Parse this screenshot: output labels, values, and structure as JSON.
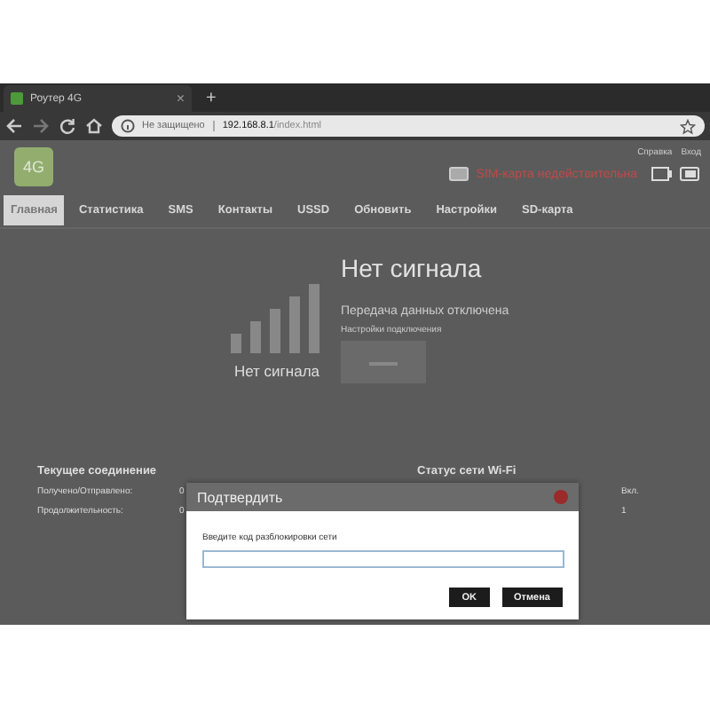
{
  "browser": {
    "tab": {
      "title": "Роутер 4G",
      "close": "×",
      "new_tab": "+"
    },
    "address": {
      "security": "Не защищено",
      "url_host": "192.168.8.1",
      "url_path": "/index.html"
    }
  },
  "header": {
    "logo": "4G",
    "links": [
      {
        "label": "Справка"
      },
      {
        "label": "Вход"
      }
    ],
    "sim_status": "SIM-карта недействительна"
  },
  "nav": [
    {
      "label": "Главная",
      "selected": true
    },
    {
      "label": "Статистика",
      "selected": false
    },
    {
      "label": "SMS",
      "selected": false
    },
    {
      "label": "Контакты",
      "selected": false
    },
    {
      "label": "USSD",
      "selected": false
    },
    {
      "label": "Обновить",
      "selected": false
    },
    {
      "label": "Настройки",
      "selected": false
    },
    {
      "label": "SD-карта",
      "selected": false
    }
  ],
  "signal": {
    "caption": "Нет сигнала",
    "title": "Нет сигнала",
    "data_status": "Передача данных отключена",
    "settings_label": "Настройки подключения",
    "connect_on": false
  },
  "connection": {
    "title": "Текущее соединение",
    "rows": [
      {
        "label": "Получено/Отправлено:",
        "value": "0"
      },
      {
        "label": "Продолжительность:",
        "value": "0"
      }
    ]
  },
  "wifi": {
    "title": "Статус сети Wi-Fi",
    "values": [
      "Вкл.",
      "1"
    ]
  },
  "dialog": {
    "title": "Подтвердить",
    "prompt": "Введите код разблокировки сети",
    "buttons": [
      "OK",
      "Отмена"
    ]
  }
}
